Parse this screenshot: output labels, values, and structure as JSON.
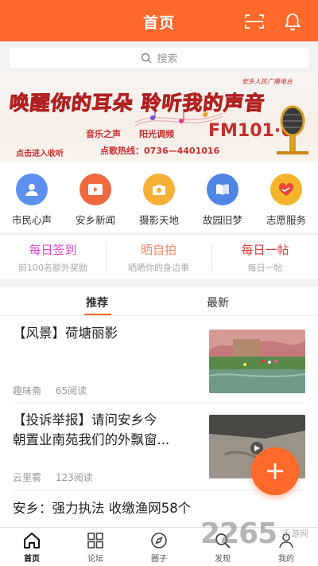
{
  "header": {
    "title": "首页"
  },
  "search": {
    "placeholder": "搜索"
  },
  "banner": {
    "station": "安乡人民广播电台",
    "headline": "唤醒你的耳朵 聆听我的声音",
    "music": "音乐之声",
    "sunshine": "阳光调频",
    "fm": "FM101·6",
    "hotline": "点歌热线：0736—4401016",
    "listen": "点击进入收听"
  },
  "quick_nav": [
    {
      "label": "市民心声",
      "icon": "citizen-voice-icon",
      "color": "#5b8ff0"
    },
    {
      "label": "安乡新闻",
      "icon": "news-video-icon",
      "color": "#f2683f"
    },
    {
      "label": "摄影天地",
      "icon": "camera-icon",
      "color": "#f7b035"
    },
    {
      "label": "故园旧梦",
      "icon": "book-icon",
      "color": "#4f86e6"
    },
    {
      "label": "志愿服务",
      "icon": "volunteer-heart-icon",
      "color": "#f5b52a"
    }
  ],
  "activities": [
    {
      "title": "每日签到",
      "subtitle": "前100名额外奖励",
      "color": "#d94dd0"
    },
    {
      "title": "晒自拍",
      "subtitle": "晒晒你的身边事",
      "color": "#ef8a6a"
    },
    {
      "title": "每日一帖",
      "subtitle": "每日一帖",
      "color": "#e03a3a"
    }
  ],
  "tabs": {
    "recommend": "推荐",
    "latest": "最新"
  },
  "articles": [
    {
      "title": "【风景】荷塘丽影",
      "author": "趣味斋",
      "views": "65阅读"
    },
    {
      "title_line1": "【投诉举报】请问安乡今",
      "title_line2": "朝置业南苑我们的外飘窗...",
      "author": "云里雾",
      "views": "123阅读"
    },
    {
      "title": "安乡：强力执法 收缴渔网58个"
    }
  ],
  "fab": {
    "label": "+"
  },
  "bottom_nav": [
    {
      "label": "首页",
      "icon": "home-icon"
    },
    {
      "label": "论坛",
      "icon": "forum-grid-icon"
    },
    {
      "label": "圈子",
      "icon": "compass-icon"
    },
    {
      "label": "发现",
      "icon": "search-discover-icon"
    },
    {
      "label": "我的",
      "icon": "profile-icon"
    }
  ],
  "watermark": {
    "text": "2265",
    "sub": "手游网"
  },
  "colors": {
    "accent": "#ff6a2b"
  }
}
